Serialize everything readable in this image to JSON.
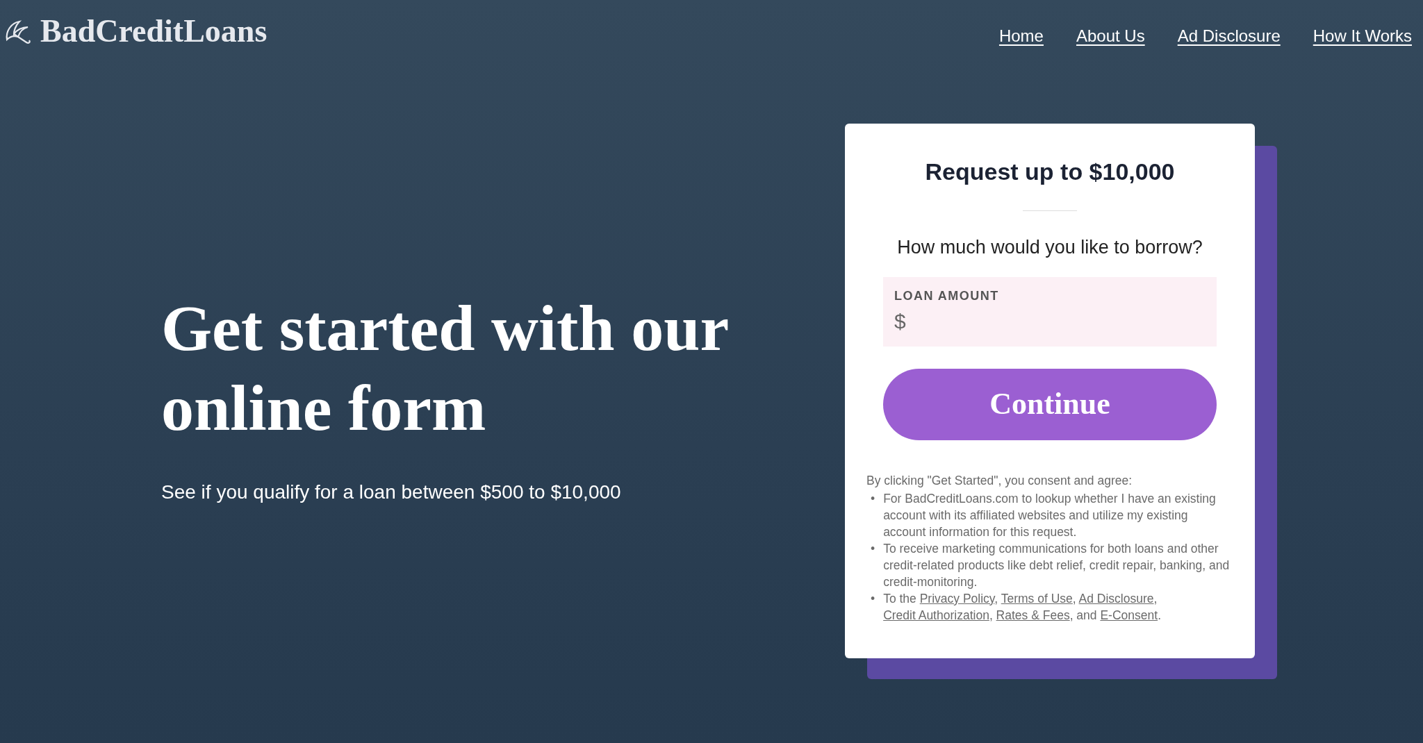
{
  "logo": {
    "text": "BadCreditLoans"
  },
  "nav": [
    {
      "label": "Home"
    },
    {
      "label": "About Us"
    },
    {
      "label": "Ad Disclosure"
    },
    {
      "label": "How It Works"
    }
  ],
  "hero": {
    "title": "Get started with our online form",
    "subtitle": "See if you qualify for a loan between $500 to $10,000"
  },
  "form": {
    "title": "Request up to $10,000",
    "question": "How much would you like to borrow?",
    "field": {
      "label": "LOAN AMOUNT",
      "prefix": "$"
    },
    "button": "Continue",
    "consent_intro": "By clicking \"Get Started\", you consent and agree:",
    "consent_items": [
      {
        "marker": "•",
        "parts": [
          {
            "kind": "text",
            "text": "For BadCreditLoans.com to lookup whether I have an existing account with its affiliated websites and utilize my existing account information for this request."
          }
        ]
      },
      {
        "marker": "•",
        "parts": [
          {
            "kind": "text",
            "text": "To receive marketing communications for both loans and other credit-related products like debt relief, credit repair, banking, and credit-monitoring."
          }
        ]
      },
      {
        "marker": "•",
        "parts": [
          {
            "kind": "text",
            "text": "To the "
          },
          {
            "kind": "link",
            "text": "Privacy Policy"
          },
          {
            "kind": "text",
            "text": ", "
          },
          {
            "kind": "link",
            "text": "Terms of Use"
          },
          {
            "kind": "text",
            "text": ", "
          },
          {
            "kind": "link",
            "text": "Ad Disclosure"
          },
          {
            "kind": "text",
            "text": ", "
          },
          {
            "kind": "link",
            "text": "Credit Authorization"
          },
          {
            "kind": "text",
            "text": ", "
          },
          {
            "kind": "link",
            "text": "Rates & Fees"
          },
          {
            "kind": "text",
            "text": ", and "
          },
          {
            "kind": "link",
            "text": "E-Consent"
          },
          {
            "kind": "text",
            "text": "."
          }
        ]
      }
    ]
  }
}
